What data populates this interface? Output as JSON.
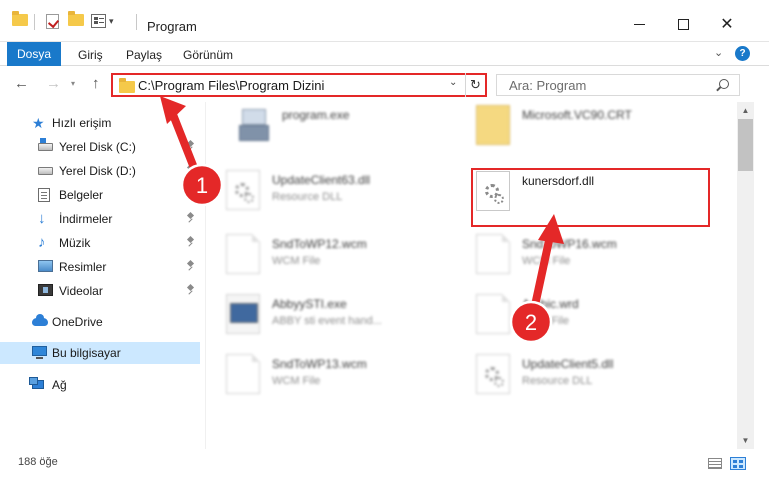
{
  "window": {
    "title": "Program",
    "minimize_icon": "minimize-icon",
    "maximize_icon": "maximize-icon",
    "close_glyph": "✕"
  },
  "quick_access_toolbar": {
    "icons": [
      "folder-icon",
      "checkmark-properties-icon",
      "new-folder-icon",
      "properties-icon"
    ],
    "caret": "▾"
  },
  "ribbon": {
    "file_tab": "Dosya",
    "tabs": [
      "Giriş",
      "Paylaş",
      "Görünüm"
    ],
    "collapse_glyph": "⌄",
    "help_glyph": "?"
  },
  "navigation": {
    "back_glyph": "←",
    "forward_glyph": "→",
    "history_glyph": "▾",
    "up_glyph": "↑",
    "address_path": "C:\\Program Files\\Program Dizini",
    "address_dropdown_glyph": "⌄",
    "refresh_glyph": "↻",
    "search_placeholder": "Ara: Program"
  },
  "sidebar": {
    "items": [
      {
        "label": "Hızlı erişim",
        "icon": "star-icon"
      },
      {
        "label": "Yerel Disk (C:)",
        "icon": "drive-icon",
        "pinned": true
      },
      {
        "label": "Yerel Disk (D:)",
        "icon": "drive-icon",
        "pinned": true
      },
      {
        "label": "Belgeler",
        "icon": "documents-icon",
        "pinned": true
      },
      {
        "label": "İndirmeler",
        "icon": "download-icon",
        "pinned": true
      },
      {
        "label": "Müzik",
        "icon": "music-icon",
        "pinned": true
      },
      {
        "label": "Resimler",
        "icon": "pictures-icon",
        "pinned": true
      },
      {
        "label": "Videolar",
        "icon": "videos-icon",
        "pinned": true
      },
      {
        "label": "OneDrive",
        "icon": "cloud-icon"
      },
      {
        "label": "Bu bilgisayar",
        "icon": "computer-icon",
        "selected": true
      },
      {
        "label": "Ağ",
        "icon": "network-icon"
      }
    ]
  },
  "files": [
    {
      "name": "program.exe",
      "type": "",
      "kind": "program"
    },
    {
      "name": "Microsoft.VC90.CRT",
      "type": "",
      "kind": "folder"
    },
    {
      "name": "UpdateClient63.dll",
      "type": "Resource DLL",
      "kind": "dll"
    },
    {
      "name": "kunersdorf.dll",
      "type": "",
      "kind": "dll",
      "highlighted": true
    },
    {
      "name": "SndToWP12.wcm",
      "type": "WCM File",
      "kind": "doc"
    },
    {
      "name": "SndToWP16.wcm",
      "type": "WCM File",
      "kind": "doc"
    },
    {
      "name": "AbbyySTI.exe",
      "type": "ABBY sti event hand...",
      "kind": "exe"
    },
    {
      "name": "Arabic.wrd",
      "type": "WRD File",
      "kind": "doc"
    },
    {
      "name": "SndToWP13.wcm",
      "type": "WCM File",
      "kind": "doc"
    },
    {
      "name": "UpdateClient5.dll",
      "type": "Resource DLL",
      "kind": "dll"
    }
  ],
  "scrollbar": {
    "up_glyph": "▲",
    "down_glyph": "▼"
  },
  "status": {
    "item_count": "188 öğe"
  },
  "annotations": {
    "step1": "1",
    "step2": "2",
    "color": "#e42828"
  }
}
